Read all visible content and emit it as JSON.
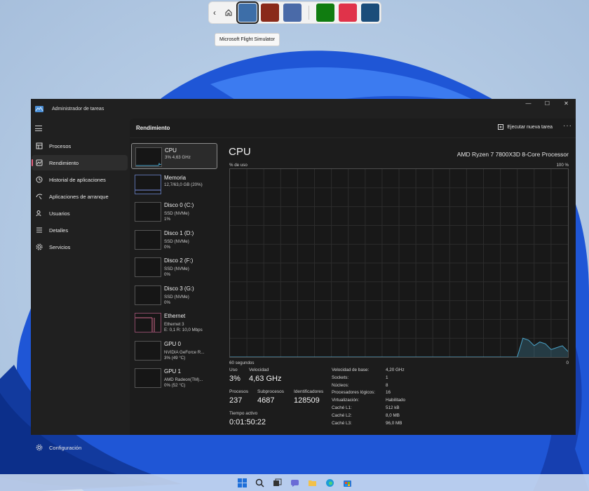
{
  "switcher": {
    "tooltip": "Microsoft Flight Simulator",
    "tiles": [
      {
        "icon": "flight-simulator-icon",
        "color": "#3d6ea8",
        "selected": true
      },
      {
        "icon": "game-icon",
        "color": "#8a2a1a"
      },
      {
        "icon": "forza-icon",
        "color": "#4a6aa8"
      },
      {
        "icon": "xbox-icon",
        "color": "#107c10"
      },
      {
        "icon": "ea-icon",
        "color": "#e0334a"
      },
      {
        "icon": "steam-icon",
        "color": "#1b4d7a"
      }
    ]
  },
  "window": {
    "title": "Administrador de tareas",
    "controls": [
      "—",
      "☐",
      "✕"
    ]
  },
  "sidebar": {
    "items": [
      {
        "label": "Procesos",
        "icon": "processes-icon"
      },
      {
        "label": "Rendimiento",
        "icon": "performance-icon",
        "active": true
      },
      {
        "label": "Historial de aplicaciones",
        "icon": "history-icon"
      },
      {
        "label": "Aplicaciones de arranque",
        "icon": "startup-icon"
      },
      {
        "label": "Usuarios",
        "icon": "users-icon"
      },
      {
        "label": "Detalles",
        "icon": "details-icon"
      },
      {
        "label": "Servicios",
        "icon": "services-icon"
      }
    ],
    "settings": "Configuración"
  },
  "header": {
    "title": "Rendimiento",
    "new_task": "Ejecutar nueva tarea",
    "more": "···"
  },
  "devices": [
    {
      "name": "CPU",
      "s1": "3% 4,63 GHz",
      "s2": "",
      "s3": "",
      "selected": true
    },
    {
      "name": "Memoria",
      "s1": "12,7/63,0 GB (20%)",
      "s2": "",
      "s3": ""
    },
    {
      "name": "Disco 0 (C:)",
      "s1": "SSD (NVMe)",
      "s2": "1%",
      "s3": ""
    },
    {
      "name": "Disco 1 (D:)",
      "s1": "SSD (NVMe)",
      "s2": "0%",
      "s3": ""
    },
    {
      "name": "Disco 2 (F:)",
      "s1": "SSD (NVMe)",
      "s2": "0%",
      "s3": ""
    },
    {
      "name": "Disco 3 (G:)",
      "s1": "SSD (NVMe)",
      "s2": "0%",
      "s3": ""
    },
    {
      "name": "Ethernet",
      "s1": "Ethernet 3",
      "s2": "E: 0,1  R: 10,0 Mbps",
      "s3": ""
    },
    {
      "name": "GPU 0",
      "s1": "NVIDIA GeForce R...",
      "s2": "3% (49 °C)",
      "s3": ""
    },
    {
      "name": "GPU 1",
      "s1": "AMD Radeon(TM)...",
      "s2": "0% (52 °C)",
      "s3": ""
    }
  ],
  "cpu": {
    "title": "CPU",
    "model": "AMD Ryzen 7 7800X3D 8-Core Processor",
    "usage_label": "% de uso",
    "max_label": "100 %",
    "time_label": "60 segundos",
    "min_label": "0",
    "graph_color": "#4aa3c8",
    "stats": {
      "uso_k": "Uso",
      "uso_v": "3%",
      "vel_k": "Velocidad",
      "vel_v": "4,63 GHz",
      "proc_k": "Procesos",
      "proc_v": "237",
      "sub_k": "Subprocesos",
      "sub_v": "4687",
      "id_k": "Identificadores",
      "id_v": "128509",
      "tiempo_k": "Tiempo activo",
      "tiempo_v": "0:01:50:22"
    },
    "specs": [
      [
        "Velocidad de base:",
        "4,20 GHz"
      ],
      [
        "Sockets:",
        "1"
      ],
      [
        "Núcleos:",
        "8"
      ],
      [
        "Procesadores lógicos:",
        "16"
      ],
      [
        "Virtualización:",
        "Habilitado"
      ],
      [
        "Caché L1:",
        "512 kB"
      ],
      [
        "Caché L2:",
        "8,0 MB"
      ],
      [
        "Caché L3:",
        "96,0 MB"
      ]
    ],
    "graph_series": [
      0,
      0,
      0,
      0,
      0,
      0,
      0,
      0,
      0,
      0,
      0,
      0,
      0,
      0,
      0,
      0,
      0,
      0,
      0,
      0,
      0,
      0,
      0,
      0,
      0,
      0,
      0,
      0,
      0,
      0,
      0,
      0,
      0,
      0,
      0,
      0,
      0,
      0,
      0,
      0,
      0,
      0,
      0,
      0,
      0,
      0,
      0,
      0,
      0,
      0,
      0,
      0,
      10,
      9,
      6,
      8,
      7,
      4,
      5,
      6,
      3
    ]
  },
  "taskbar": {
    "icons": [
      "start-icon",
      "search-icon",
      "task-view-icon",
      "chat-icon",
      "file-explorer-icon",
      "edge-icon",
      "store-icon"
    ]
  }
}
